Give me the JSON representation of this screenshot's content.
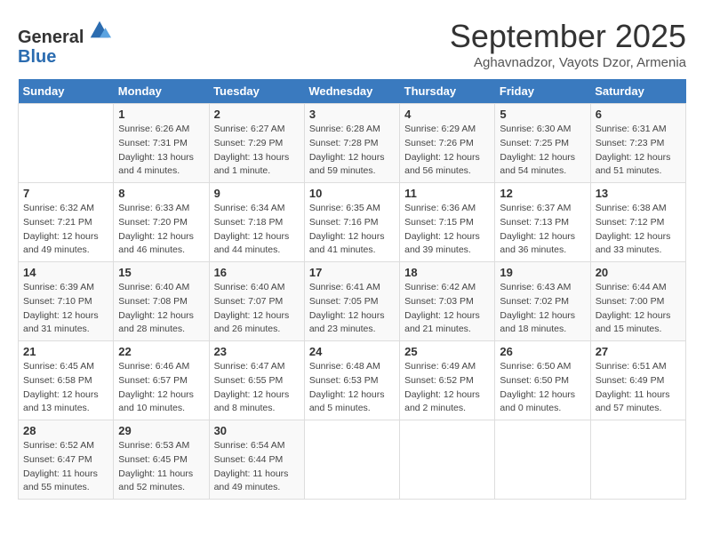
{
  "header": {
    "logo_line1": "General",
    "logo_line2": "Blue",
    "month_title": "September 2025",
    "location": "Aghavnadzor, Vayots Dzor, Armenia"
  },
  "weekdays": [
    "Sunday",
    "Monday",
    "Tuesday",
    "Wednesday",
    "Thursday",
    "Friday",
    "Saturday"
  ],
  "weeks": [
    [
      {
        "day": "",
        "info": ""
      },
      {
        "day": "1",
        "info": "Sunrise: 6:26 AM\nSunset: 7:31 PM\nDaylight: 13 hours\nand 4 minutes."
      },
      {
        "day": "2",
        "info": "Sunrise: 6:27 AM\nSunset: 7:29 PM\nDaylight: 13 hours\nand 1 minute."
      },
      {
        "day": "3",
        "info": "Sunrise: 6:28 AM\nSunset: 7:28 PM\nDaylight: 12 hours\nand 59 minutes."
      },
      {
        "day": "4",
        "info": "Sunrise: 6:29 AM\nSunset: 7:26 PM\nDaylight: 12 hours\nand 56 minutes."
      },
      {
        "day": "5",
        "info": "Sunrise: 6:30 AM\nSunset: 7:25 PM\nDaylight: 12 hours\nand 54 minutes."
      },
      {
        "day": "6",
        "info": "Sunrise: 6:31 AM\nSunset: 7:23 PM\nDaylight: 12 hours\nand 51 minutes."
      }
    ],
    [
      {
        "day": "7",
        "info": "Sunrise: 6:32 AM\nSunset: 7:21 PM\nDaylight: 12 hours\nand 49 minutes."
      },
      {
        "day": "8",
        "info": "Sunrise: 6:33 AM\nSunset: 7:20 PM\nDaylight: 12 hours\nand 46 minutes."
      },
      {
        "day": "9",
        "info": "Sunrise: 6:34 AM\nSunset: 7:18 PM\nDaylight: 12 hours\nand 44 minutes."
      },
      {
        "day": "10",
        "info": "Sunrise: 6:35 AM\nSunset: 7:16 PM\nDaylight: 12 hours\nand 41 minutes."
      },
      {
        "day": "11",
        "info": "Sunrise: 6:36 AM\nSunset: 7:15 PM\nDaylight: 12 hours\nand 39 minutes."
      },
      {
        "day": "12",
        "info": "Sunrise: 6:37 AM\nSunset: 7:13 PM\nDaylight: 12 hours\nand 36 minutes."
      },
      {
        "day": "13",
        "info": "Sunrise: 6:38 AM\nSunset: 7:12 PM\nDaylight: 12 hours\nand 33 minutes."
      }
    ],
    [
      {
        "day": "14",
        "info": "Sunrise: 6:39 AM\nSunset: 7:10 PM\nDaylight: 12 hours\nand 31 minutes."
      },
      {
        "day": "15",
        "info": "Sunrise: 6:40 AM\nSunset: 7:08 PM\nDaylight: 12 hours\nand 28 minutes."
      },
      {
        "day": "16",
        "info": "Sunrise: 6:40 AM\nSunset: 7:07 PM\nDaylight: 12 hours\nand 26 minutes."
      },
      {
        "day": "17",
        "info": "Sunrise: 6:41 AM\nSunset: 7:05 PM\nDaylight: 12 hours\nand 23 minutes."
      },
      {
        "day": "18",
        "info": "Sunrise: 6:42 AM\nSunset: 7:03 PM\nDaylight: 12 hours\nand 21 minutes."
      },
      {
        "day": "19",
        "info": "Sunrise: 6:43 AM\nSunset: 7:02 PM\nDaylight: 12 hours\nand 18 minutes."
      },
      {
        "day": "20",
        "info": "Sunrise: 6:44 AM\nSunset: 7:00 PM\nDaylight: 12 hours\nand 15 minutes."
      }
    ],
    [
      {
        "day": "21",
        "info": "Sunrise: 6:45 AM\nSunset: 6:58 PM\nDaylight: 12 hours\nand 13 minutes."
      },
      {
        "day": "22",
        "info": "Sunrise: 6:46 AM\nSunset: 6:57 PM\nDaylight: 12 hours\nand 10 minutes."
      },
      {
        "day": "23",
        "info": "Sunrise: 6:47 AM\nSunset: 6:55 PM\nDaylight: 12 hours\nand 8 minutes."
      },
      {
        "day": "24",
        "info": "Sunrise: 6:48 AM\nSunset: 6:53 PM\nDaylight: 12 hours\nand 5 minutes."
      },
      {
        "day": "25",
        "info": "Sunrise: 6:49 AM\nSunset: 6:52 PM\nDaylight: 12 hours\nand 2 minutes."
      },
      {
        "day": "26",
        "info": "Sunrise: 6:50 AM\nSunset: 6:50 PM\nDaylight: 12 hours\nand 0 minutes."
      },
      {
        "day": "27",
        "info": "Sunrise: 6:51 AM\nSunset: 6:49 PM\nDaylight: 11 hours\nand 57 minutes."
      }
    ],
    [
      {
        "day": "28",
        "info": "Sunrise: 6:52 AM\nSunset: 6:47 PM\nDaylight: 11 hours\nand 55 minutes."
      },
      {
        "day": "29",
        "info": "Sunrise: 6:53 AM\nSunset: 6:45 PM\nDaylight: 11 hours\nand 52 minutes."
      },
      {
        "day": "30",
        "info": "Sunrise: 6:54 AM\nSunset: 6:44 PM\nDaylight: 11 hours\nand 49 minutes."
      },
      {
        "day": "",
        "info": ""
      },
      {
        "day": "",
        "info": ""
      },
      {
        "day": "",
        "info": ""
      },
      {
        "day": "",
        "info": ""
      }
    ]
  ]
}
